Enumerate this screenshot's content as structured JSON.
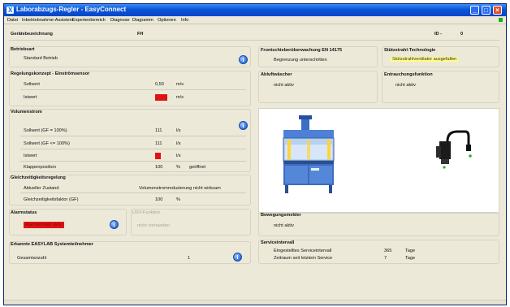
{
  "window": {
    "title": "Laborabzugs-Regler  -  EasyConnect"
  },
  "menu": [
    "Datei",
    "Inbetriebnahme-Assistent",
    "Expertenbereich",
    "Diagnose",
    "Diagramm",
    "Optionen",
    "Info"
  ],
  "header": {
    "label": "Gerätebezeichnung",
    "value": "FH",
    "id_label": "ID -",
    "id_value": "0"
  },
  "betriebsart": {
    "title": "Betriebsart",
    "value": "Standard Betrieb"
  },
  "regelung": {
    "title": "Regelungskonzept - Einströmsensor",
    "rows": [
      {
        "label": "Sollwert",
        "value": "0,50",
        "unit": "m/s"
      },
      {
        "label": "Istwert",
        "value": "0,00",
        "unit": "m/s"
      }
    ]
  },
  "volumenstrom": {
    "title": "Volumenstrom",
    "rows": [
      {
        "label": "Sollwert (GF = 100%)",
        "value": "111",
        "unit": "l/s",
        "extra": ""
      },
      {
        "label": "Sollwert (GF <= 100%)",
        "value": "111",
        "unit": "l/s",
        "extra": ""
      },
      {
        "label": "Istwert",
        "value": "0",
        "unit": "l/s",
        "extra": ""
      },
      {
        "label": "Klappenposition",
        "value": "100",
        "unit": "%",
        "extra": "geöffnet"
      }
    ]
  },
  "gleich": {
    "title": "Gleichzeitigkeitsregelung",
    "rows": [
      {
        "label": "Aktueller Zustand",
        "value": "Volumenstromreduzierung nicht wirksam",
        "unit": ""
      },
      {
        "label": "Gleichzeitigkeitsfaktor (GF)",
        "value": "100",
        "unit": "%"
      }
    ]
  },
  "alarm": {
    "title": "Alarmstatus",
    "value": "Alarmkontakt aktiv"
  },
  "usv": {
    "title": "USV-Funktion",
    "value": "nicht vorhanden"
  },
  "easylab": {
    "title": "Erkannte EASYLAB Systemteilnehmer",
    "label": "Gesamtanzahl",
    "value": "1"
  },
  "frontschieber": {
    "title": "Frontschieberüberwachung EN 14175",
    "value": "Begrenzung unterschritten"
  },
  "stuetzstrahl": {
    "title": "Stützstrahl-Technologie",
    "value": "Stützstrahlventilator ausgefallen"
  },
  "abluft": {
    "title": "Abluftwäscher",
    "value": "nicht aktiv"
  },
  "entrauchung": {
    "title": "Entrauchungsfunktion",
    "value": "nicht aktiv"
  },
  "bewegung": {
    "title": "Bewegungsmelder",
    "value": "nicht aktiv"
  },
  "service": {
    "title": "Serviceintervall",
    "rows": [
      {
        "label": "Eingestelltes Serviceintervall",
        "value": "365",
        "unit": "Tage"
      },
      {
        "label": "Zeitraum seit letztem Service",
        "value": "7",
        "unit": "Tage"
      }
    ]
  },
  "colors": {
    "alarm_red": "#e01313",
    "warning_yellow": "#fffb83",
    "titlebar_blue": "#0a54d8"
  }
}
